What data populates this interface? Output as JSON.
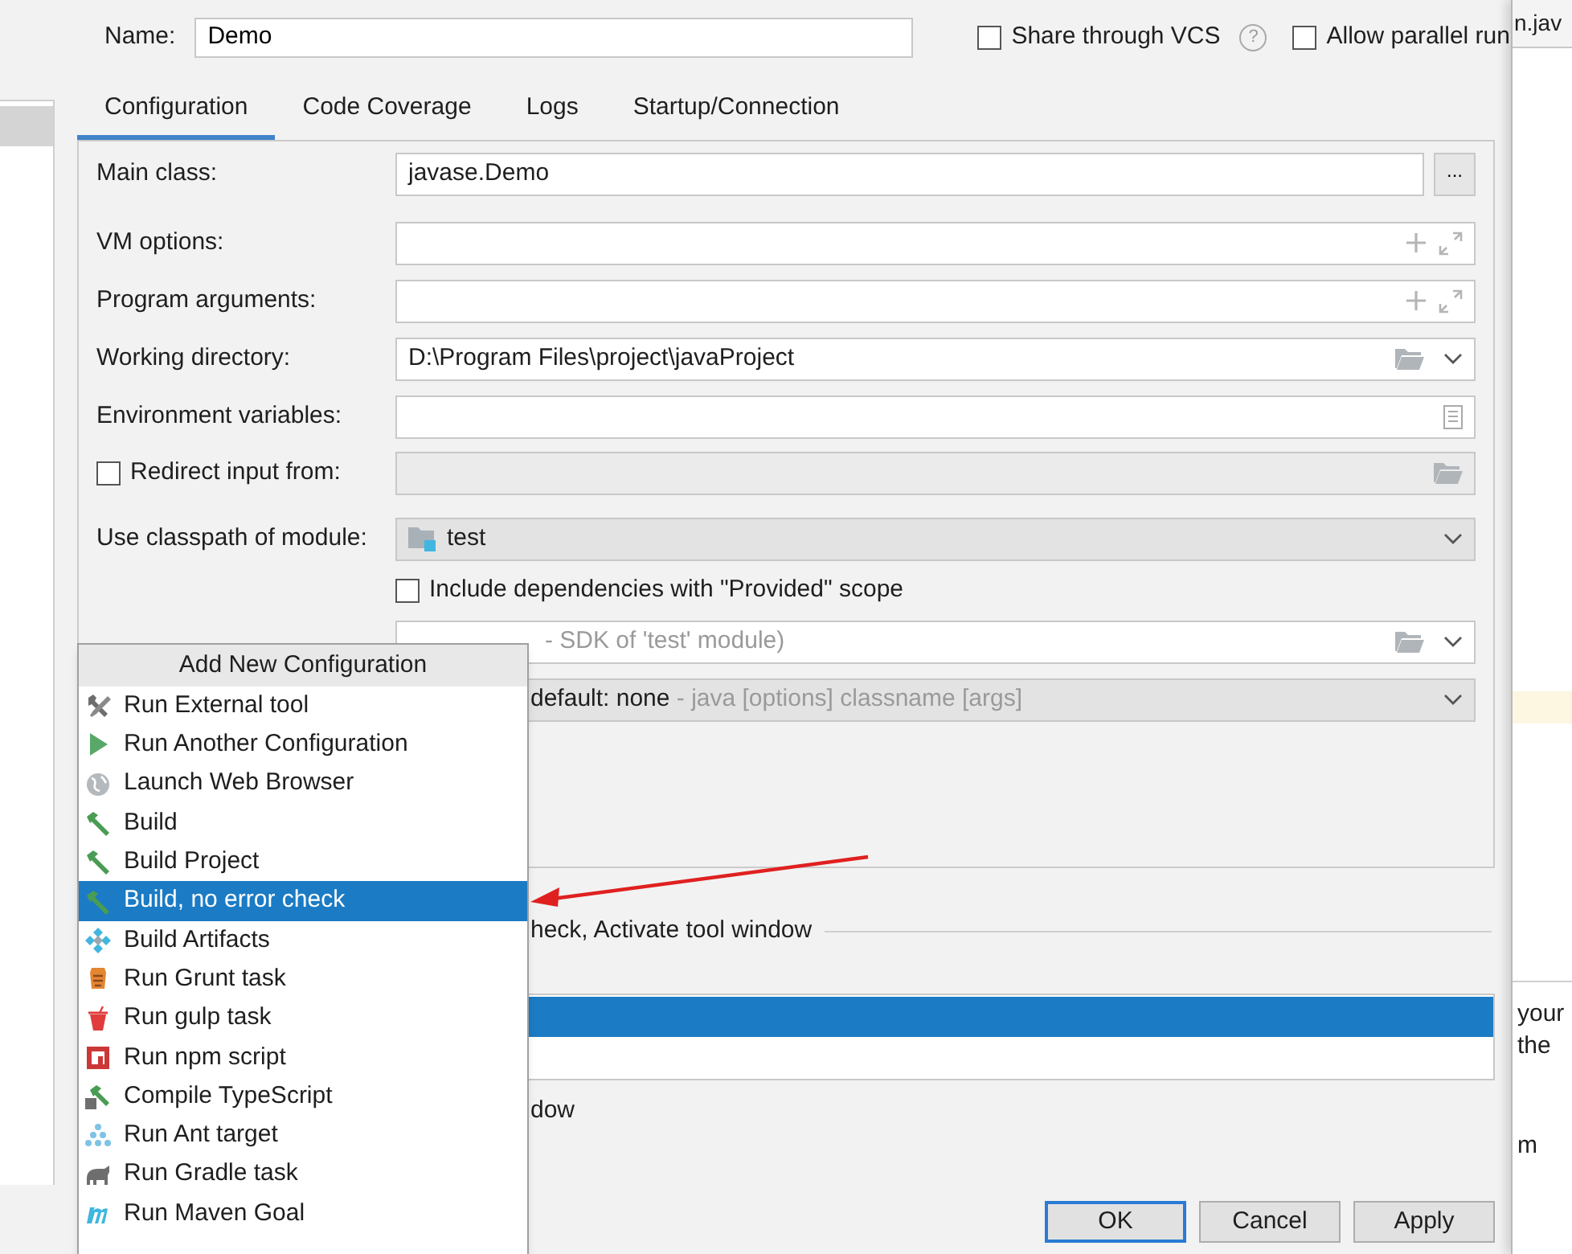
{
  "background_window": {
    "tab": "n.jav",
    "lines": [
      "your",
      "the",
      "m"
    ]
  },
  "name": {
    "label": "Name:",
    "value": "Demo"
  },
  "options": [
    {
      "label": "Share through VCS",
      "checked": false,
      "help": "?"
    },
    {
      "label": "Allow parallel run",
      "checked": false
    }
  ],
  "tabs": [
    {
      "label": "Configuration",
      "selected": true
    },
    {
      "label": "Code Coverage",
      "selected": false
    },
    {
      "label": "Logs",
      "selected": false
    },
    {
      "label": "Startup/Connection",
      "selected": false
    }
  ],
  "fields": [
    {
      "kind": "browse",
      "label": "Main class:",
      "value": "javase.Demo",
      "button": "..."
    },
    {
      "kind": "expand",
      "label": "VM options:"
    },
    {
      "kind": "expand",
      "label": "Program arguments:"
    },
    {
      "kind": "folder",
      "label": "Working directory:",
      "value": "D:\\Program Files\\project\\javaProject"
    },
    {
      "kind": "env",
      "label": "Environment variables:"
    },
    {
      "kind": "redirect",
      "label": "Redirect input from:",
      "checked": false
    },
    {
      "kind": "module",
      "label": "Use classpath of module:",
      "value": "test"
    },
    {
      "kind": "check",
      "label": "Include dependencies with \"Provided\" scope",
      "checked": false
    },
    {
      "kind": "jre",
      "hint": "- SDK of 'test' module)"
    },
    {
      "kind": "select",
      "value": "default: none",
      "hint": "- java [options] classname [args]"
    }
  ],
  "before_launch": {
    "label": "heck, Activate tool window",
    "rows": [
      {
        "selected": true
      },
      {
        "selected": false
      }
    ]
  },
  "window_option": "dow",
  "buttons": [
    {
      "label": "OK",
      "default": true
    },
    {
      "label": "Cancel",
      "default": false
    },
    {
      "label": "Apply",
      "default": false
    }
  ],
  "popup": {
    "title": "Add New Configuration",
    "items": [
      {
        "kind": "tools",
        "label": "Run External tool",
        "selected": false
      },
      {
        "kind": "play",
        "label": "Run Another Configuration",
        "selected": false
      },
      {
        "kind": "globe",
        "label": "Launch Web Browser",
        "selected": false
      },
      {
        "kind": "hammer",
        "label": "Build",
        "selected": false
      },
      {
        "kind": "hammer",
        "label": "Build Project",
        "selected": false
      },
      {
        "kind": "hammer",
        "label": "Build, no error check",
        "selected": true
      },
      {
        "kind": "artifacts",
        "label": "Build Artifacts",
        "selected": false
      },
      {
        "kind": "grunt",
        "label": "Run Grunt task",
        "selected": false
      },
      {
        "kind": "gulp",
        "label": "Run gulp task",
        "selected": false
      },
      {
        "kind": "npm",
        "label": "Run npm script",
        "selected": false
      },
      {
        "kind": "typescript",
        "label": "Compile TypeScript",
        "selected": false
      },
      {
        "kind": "ant",
        "label": "Run Ant target",
        "selected": false
      },
      {
        "kind": "gradle",
        "label": "Run Gradle task",
        "selected": false
      },
      {
        "kind": "maven",
        "label": "Run Maven Goal",
        "selected": false
      }
    ]
  }
}
